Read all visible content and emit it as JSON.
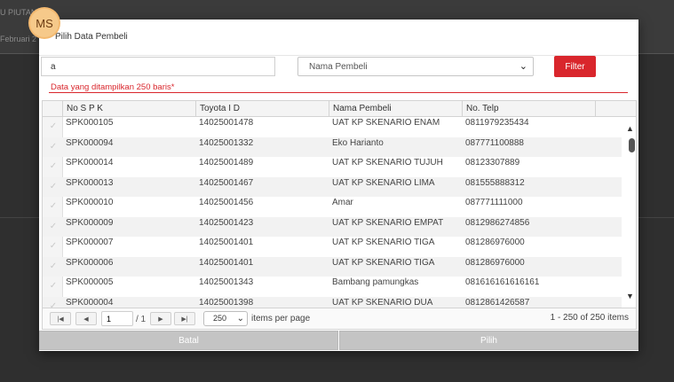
{
  "background": {
    "top_text": "U PIUTANG",
    "side_text": "Februari 2"
  },
  "user": {
    "initials": "MS"
  },
  "modal": {
    "title": "Pilih Data Pembeli",
    "search_value": "a",
    "filter_field": "Nama Pembeli",
    "filter_label": "Filter",
    "note": "Data yang ditampilkan 250 baris*"
  },
  "grid": {
    "columns": [
      "No S P K",
      "Toyota I D",
      "Nama Pembeli",
      "No. Telp"
    ],
    "rows": [
      [
        "SPK000105",
        "14025001478",
        "UAT KP SKENARIO ENAM",
        "0811979235434"
      ],
      [
        "SPK000094",
        "14025001332",
        "Eko Harianto",
        "087771100888"
      ],
      [
        "SPK000014",
        "14025001489",
        "UAT KP SKENARIO TUJUH",
        "08123307889"
      ],
      [
        "SPK000013",
        "14025001467",
        "UAT KP SKENARIO LIMA",
        "081555888312"
      ],
      [
        "SPK000010",
        "14025001456",
        "Amar",
        "087771111000"
      ],
      [
        "SPK000009",
        "14025001423",
        "UAT KP SKENARIO EMPAT",
        "0812986274856"
      ],
      [
        "SPK000007",
        "14025001401",
        "UAT KP SKENARIO TIGA",
        "081286976000"
      ],
      [
        "SPK000006",
        "14025001401",
        "UAT KP SKENARIO TIGA",
        "081286976000"
      ],
      [
        "SPK000005",
        "14025001343",
        "Bambang pamungkas",
        "081616161616161"
      ],
      [
        "SPK000004",
        "14025001398",
        "UAT KP SKENARIO DUA",
        "0812861426587"
      ]
    ]
  },
  "pager": {
    "current_page": "1",
    "total_pages": "/ 1",
    "page_size": "250",
    "page_size_label": "items per page",
    "info": "1 - 250 of 250 items"
  },
  "footer": {
    "cancel_label": "Batal",
    "select_label": "Pilih"
  }
}
